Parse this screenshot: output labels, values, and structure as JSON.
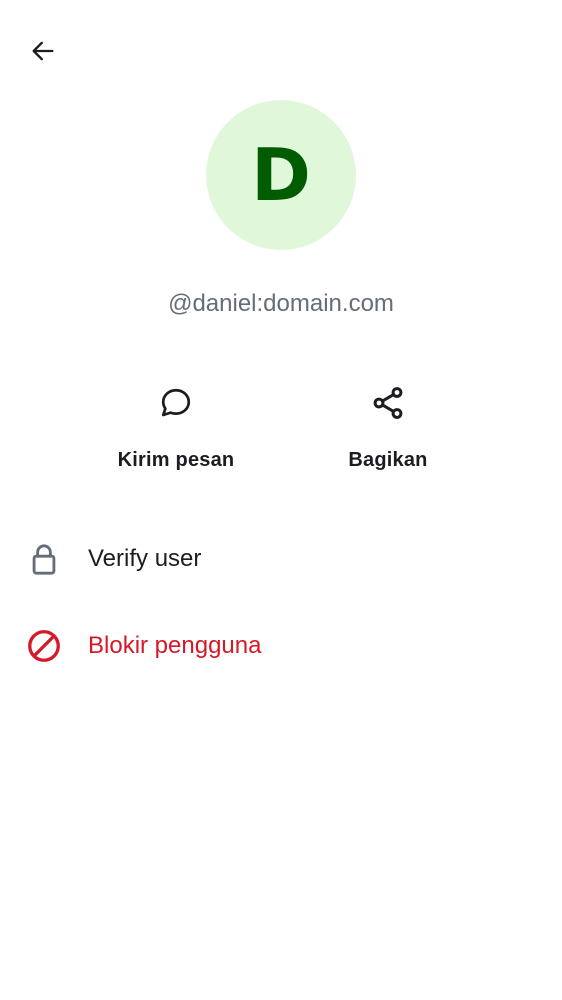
{
  "header": {
    "back_icon": "arrow-left-icon"
  },
  "profile": {
    "avatar_initial": "D",
    "avatar_bg_color": "#e0f8d9",
    "avatar_text_color": "#005c00",
    "user_id": "@daniel:domain.com"
  },
  "actions": {
    "message": {
      "label": "Kirim pesan",
      "icon": "chat-bubble-icon"
    },
    "share": {
      "label": "Bagikan",
      "icon": "share-icon"
    }
  },
  "list": {
    "verify": {
      "label": "Verify user",
      "icon": "lock-icon"
    },
    "block": {
      "label": "Blokir pengguna",
      "icon": "block-icon",
      "color": "#d51928"
    }
  }
}
